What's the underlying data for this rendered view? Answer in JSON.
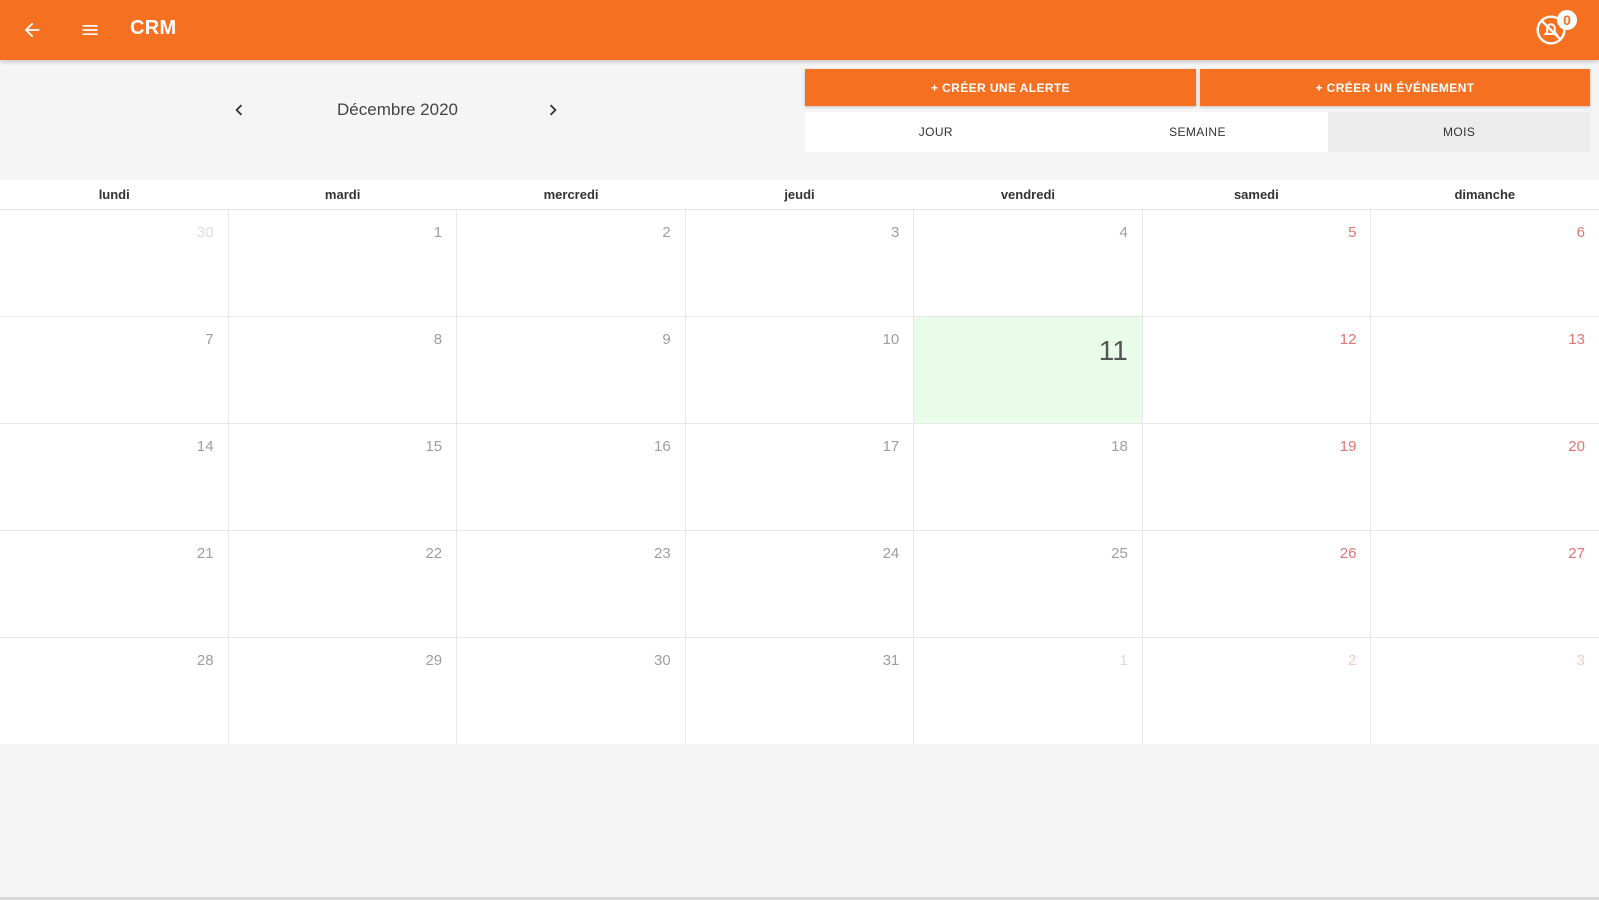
{
  "appbar": {
    "title": "CRM",
    "notification_count": "0",
    "icons": {
      "back": "arrow-left-icon",
      "menu": "hamburger-menu-icon",
      "notifications": "bell-off-icon"
    },
    "color": "#f57021"
  },
  "toolbar": {
    "month": "Décembre 2020",
    "create_alert": "+ CRÉER UNE ALERTE",
    "create_event": "+ CRÉER UN ÉVÉNEMENT",
    "tabs": [
      "JOUR",
      "SEMAINE",
      "MOIS"
    ],
    "active_tab": "MOIS"
  },
  "calendar": {
    "weekdays": [
      "lundi",
      "mardi",
      "mercredi",
      "jeudi",
      "vendredi",
      "samedi",
      "dimanche"
    ],
    "weeks": [
      [
        {
          "day": "30",
          "outside": true
        },
        {
          "day": "1"
        },
        {
          "day": "2"
        },
        {
          "day": "3"
        },
        {
          "day": "4"
        },
        {
          "day": "5",
          "weekend": true
        },
        {
          "day": "6",
          "weekend": true
        }
      ],
      [
        {
          "day": "7"
        },
        {
          "day": "8"
        },
        {
          "day": "9"
        },
        {
          "day": "10"
        },
        {
          "day": "11",
          "today": true
        },
        {
          "day": "12",
          "weekend": true
        },
        {
          "day": "13",
          "weekend": true
        }
      ],
      [
        {
          "day": "14"
        },
        {
          "day": "15"
        },
        {
          "day": "16"
        },
        {
          "day": "17"
        },
        {
          "day": "18"
        },
        {
          "day": "19",
          "weekend": true
        },
        {
          "day": "20",
          "weekend": true
        }
      ],
      [
        {
          "day": "21"
        },
        {
          "day": "22"
        },
        {
          "day": "23"
        },
        {
          "day": "24"
        },
        {
          "day": "25"
        },
        {
          "day": "26",
          "weekend": true
        },
        {
          "day": "27",
          "weekend": true
        }
      ],
      [
        {
          "day": "28"
        },
        {
          "day": "29"
        },
        {
          "day": "30"
        },
        {
          "day": "31"
        },
        {
          "day": "1",
          "outside": true
        },
        {
          "day": "2",
          "outside": true,
          "weekend": true
        },
        {
          "day": "3",
          "outside": true,
          "weekend": true
        }
      ]
    ],
    "today_color": "#e9fbe9",
    "weekend_color": "#e57373"
  }
}
